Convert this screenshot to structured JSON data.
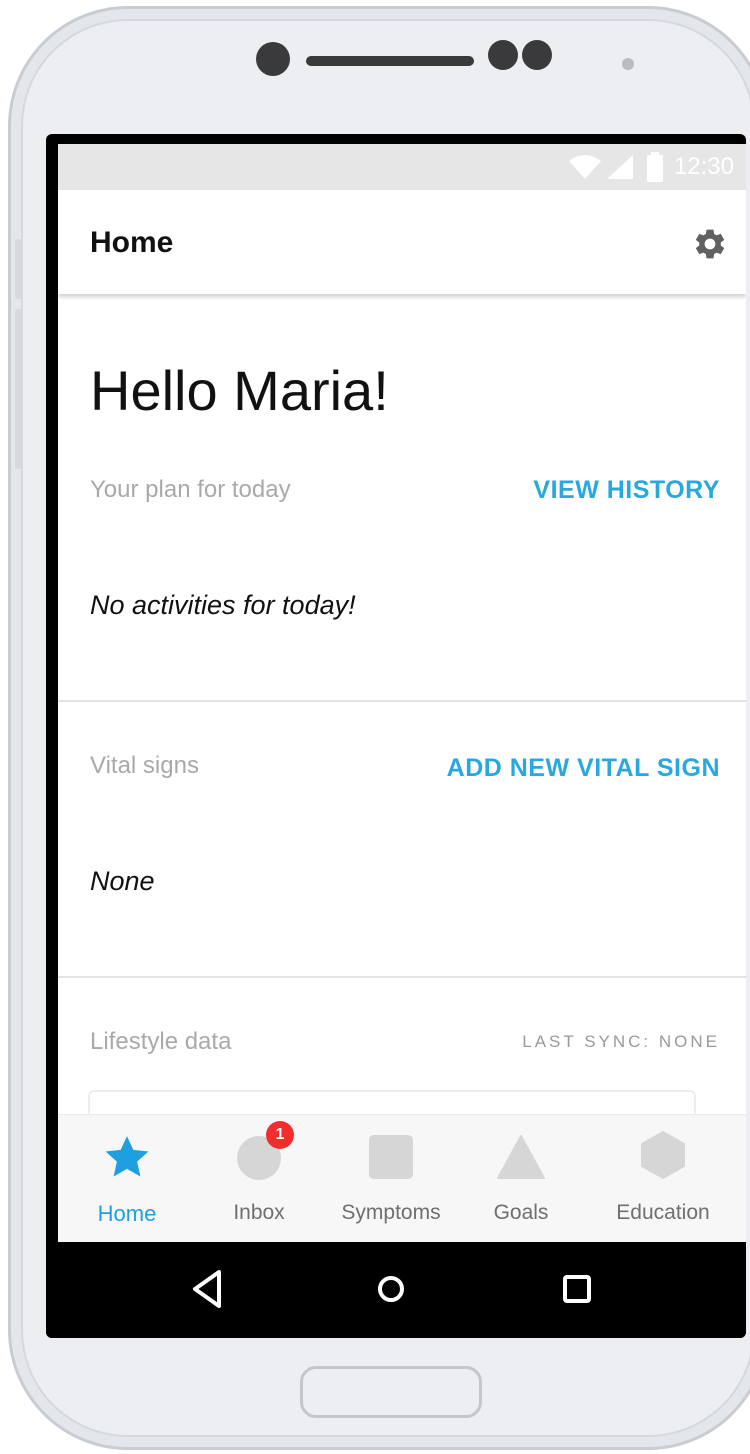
{
  "status_bar": {
    "time": "12:30",
    "icons": [
      "wifi-icon",
      "cell-signal-icon",
      "battery-icon"
    ]
  },
  "app_bar": {
    "title": "Home",
    "settings_icon": "gear-icon"
  },
  "greeting": "Hello Maria!",
  "plan_section": {
    "label": "Your plan for today",
    "action": "VIEW HISTORY",
    "empty_text": "No activities for today!"
  },
  "vitals_section": {
    "label": "Vital signs",
    "action": "ADD NEW VITAL SIGN",
    "empty_text": "None"
  },
  "lifestyle_section": {
    "label": "Lifestyle data",
    "sync_status": "LAST SYNC: NONE"
  },
  "bottom_nav": {
    "items": [
      {
        "label": "Home",
        "icon": "star-icon",
        "active": true
      },
      {
        "label": "Inbox",
        "icon": "circle-icon",
        "badge": "1"
      },
      {
        "label": "Symptoms",
        "icon": "square-icon"
      },
      {
        "label": "Goals",
        "icon": "triangle-icon"
      },
      {
        "label": "Education",
        "icon": "hexagon-icon"
      }
    ]
  },
  "system_nav": {
    "icons": [
      "back-icon",
      "home-icon",
      "recents-icon"
    ]
  },
  "colors": {
    "accent": "#29A8E0",
    "badge": "#F32D2D",
    "muted_text": "#A9A9A9"
  }
}
